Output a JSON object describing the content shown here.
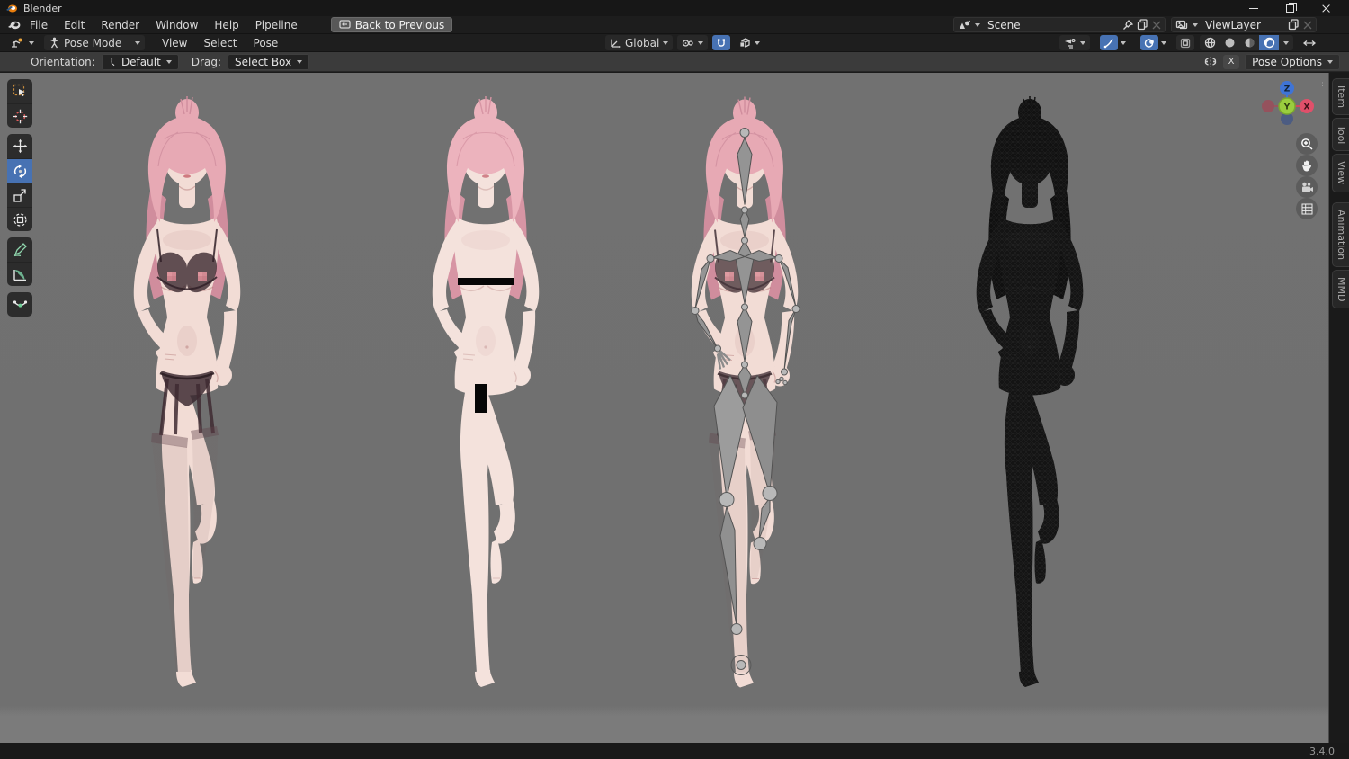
{
  "window": {
    "title": "Blender"
  },
  "topbar": {
    "menus": [
      "File",
      "Edit",
      "Render",
      "Window",
      "Help",
      "Pipeline"
    ],
    "back_button": "Back to Previous",
    "scene_label": "Scene",
    "viewlayer_label": "ViewLayer"
  },
  "header": {
    "mode_label": "Pose Mode",
    "menus": [
      "View",
      "Select",
      "Pose"
    ],
    "orientation_label": "Global",
    "shading_modes": [
      "wireframe",
      "solid",
      "material-preview",
      "rendered"
    ],
    "active_shading": "rendered",
    "snapping_enabled": true,
    "gizmos_enabled": true,
    "overlays_enabled": true
  },
  "tool_settings": {
    "orientation_label": "Orientation:",
    "orientation_value": "Default",
    "drag_label": "Drag:",
    "drag_value": "Select Box",
    "mirror_x": "X",
    "pose_options": "Pose Options"
  },
  "toolbar": {
    "tools": [
      {
        "name": "select-box",
        "active": false
      },
      {
        "name": "cursor",
        "active": false
      },
      {
        "name": "move",
        "active": false
      },
      {
        "name": "rotate",
        "active": true
      },
      {
        "name": "scale",
        "active": false
      },
      {
        "name": "transform",
        "active": false
      },
      {
        "name": "annotate",
        "active": false
      },
      {
        "name": "measure",
        "active": false
      },
      {
        "name": "pose-breakdowner",
        "active": false
      }
    ]
  },
  "viewport": {
    "models": [
      {
        "name": "character-textured-lingerie",
        "variant": "rendered"
      },
      {
        "name": "character-body-censored",
        "variant": "rendered",
        "censor_bars": 2
      },
      {
        "name": "character-with-armature-bones",
        "variant": "rendered+armature"
      },
      {
        "name": "character-wireframe",
        "variant": "wireframe"
      }
    ],
    "gizmo": {
      "x": "X",
      "y": "Y",
      "z": "Z"
    },
    "nav_buttons": [
      "zoom",
      "pan",
      "camera-view",
      "orthographic-grid"
    ]
  },
  "sidebar_tabs": [
    "Item",
    "Tool",
    "View",
    "Animation",
    "MMD"
  ],
  "status": {
    "version": "3.4.0"
  },
  "icons": {
    "blender-logo": "stylized orange/white blender mark",
    "dropdown-caret": "css-triangle-down",
    "pin": "svg",
    "duplicate": "svg",
    "close-x": "css-cross",
    "minimize": "css-bar",
    "maximize": "css-squares",
    "editor-type": "svg",
    "pose-mode-figure": "svg",
    "transform-orientation-axes": "svg",
    "pivot-point": "svg",
    "snap-magnet": "svg",
    "snap-target-cube": "svg",
    "filter-eye": "svg",
    "gizmo-toggle": "svg",
    "overlays-toggle": "svg",
    "xray-toggle": "svg",
    "shading-spheres": "svg",
    "width-resize-arrows": "svg",
    "mirror-x-axis": "svg",
    "zoom-magnifier": "svg",
    "pan-hand": "svg",
    "view-camera": "svg",
    "ortho-grid": "svg"
  },
  "colors": {
    "accent_blue": "#4772b3",
    "viewport_gray": "#717171",
    "panel_dark": "#1d1d1d",
    "tool_settings_bar": "#3b3b3b",
    "axis_x_red": "#e0506a",
    "axis_y_green": "#9acd3e",
    "axis_z_blue": "#3f74d6",
    "hair_pink": "#e7a9b4",
    "skin": "#f2dcd5"
  }
}
